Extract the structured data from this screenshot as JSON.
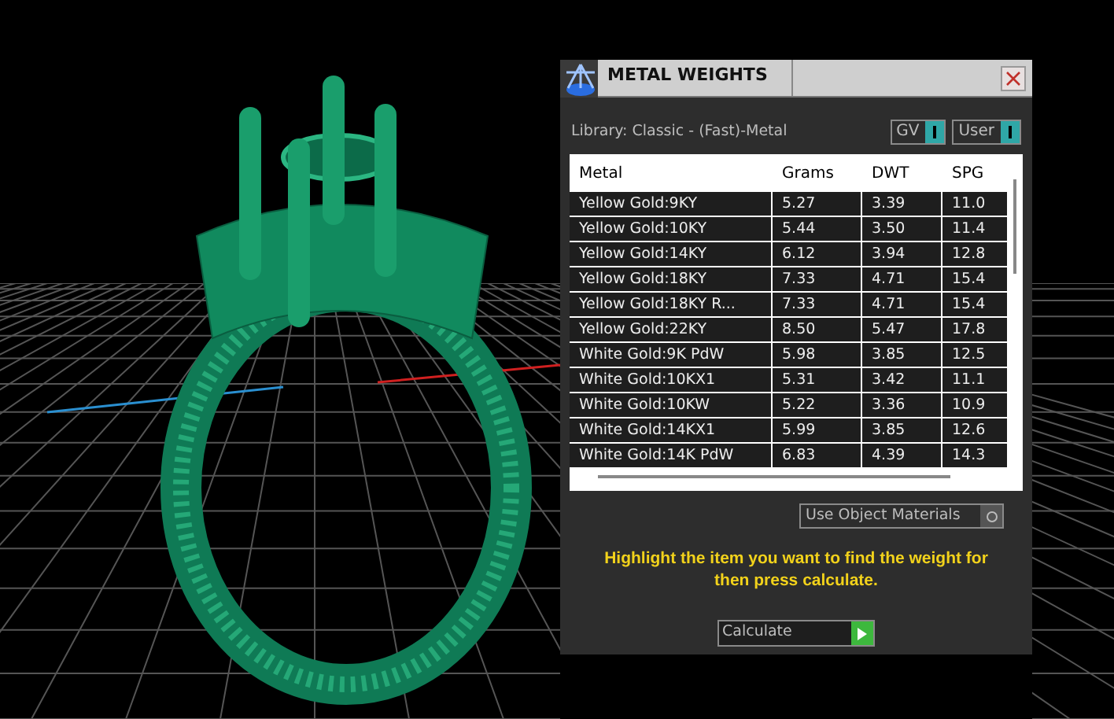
{
  "panel": {
    "title": "METAL WEIGHTS",
    "library": "Library: Classic - (Fast)-Metal",
    "toggles": [
      {
        "label": "GV",
        "on": true
      },
      {
        "label": "User",
        "on": true
      }
    ],
    "table": {
      "columns": [
        "Metal",
        "Grams",
        "DWT",
        "SPG"
      ],
      "rows": [
        [
          "Yellow Gold:9KY",
          "5.27",
          "3.39",
          "11.0"
        ],
        [
          "Yellow Gold:10KY",
          "5.44",
          "3.50",
          "11.4"
        ],
        [
          "Yellow Gold:14KY",
          "6.12",
          "3.94",
          "12.8"
        ],
        [
          "Yellow Gold:18KY",
          "7.33",
          "4.71",
          "15.4"
        ],
        [
          "Yellow Gold:18KY R...",
          "7.33",
          "4.71",
          "15.4"
        ],
        [
          "Yellow Gold:22KY",
          "8.50",
          "5.47",
          "17.8"
        ],
        [
          "White Gold:9K PdW",
          "5.98",
          "3.85",
          "12.5"
        ],
        [
          "White Gold:10KX1",
          "5.31",
          "3.42",
          "11.1"
        ],
        [
          "White Gold:10KW",
          "5.22",
          "3.36",
          "10.9"
        ],
        [
          "White Gold:14KX1",
          "5.99",
          "3.85",
          "12.6"
        ],
        [
          "White Gold:14K PdW",
          "6.83",
          "4.39",
          "14.3"
        ]
      ]
    },
    "use_object_materials": {
      "label": "Use Object Materials",
      "on": false
    },
    "hint": "Highlight the item you want to find the weight for then press calculate.",
    "calculate_button": "Calculate"
  }
}
